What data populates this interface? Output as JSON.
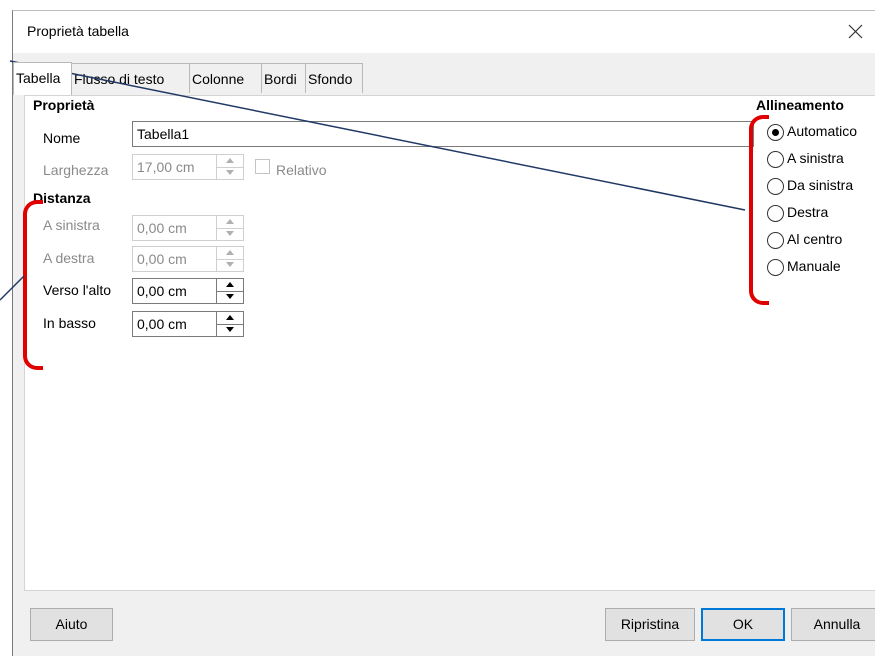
{
  "dialog": {
    "title": "Proprietà tabella"
  },
  "tabs": [
    {
      "label": "Tabella",
      "active": true
    },
    {
      "label": "Flusso di testo",
      "active": false
    },
    {
      "label": "Colonne",
      "active": false
    },
    {
      "label": "Bordi",
      "active": false
    },
    {
      "label": "Sfondo",
      "active": false
    }
  ],
  "proprieta": {
    "heading": "Proprietà",
    "nome_label": "Nome",
    "nome_value": "Tabella1",
    "larghezza_label": "Larghezza",
    "larghezza_value": "17,00 cm",
    "relativo_label": "Relativo"
  },
  "distanza": {
    "heading": "Distanza",
    "rows": [
      {
        "label": "A sinistra",
        "value": "0,00 cm",
        "enabled": false
      },
      {
        "label": "A destra",
        "value": "0,00 cm",
        "enabled": false
      },
      {
        "label": "Verso l'alto",
        "value": "0,00 cm",
        "enabled": true
      },
      {
        "label": "In basso",
        "value": "0,00 cm",
        "enabled": true
      }
    ]
  },
  "allineamento": {
    "heading": "Allineamento",
    "options": [
      {
        "label": "Automatico",
        "selected": true
      },
      {
        "label": "A sinistra",
        "selected": false
      },
      {
        "label": "Da sinistra",
        "selected": false
      },
      {
        "label": "Destra",
        "selected": false
      },
      {
        "label": "Al centro",
        "selected": false
      },
      {
        "label": "Manuale",
        "selected": false
      }
    ]
  },
  "buttons": {
    "help": "Aiuto",
    "reset": "Ripristina",
    "ok": "OK",
    "cancel": "Annulla"
  },
  "annotation_color": "#e00000",
  "line_color": "#1f3864"
}
